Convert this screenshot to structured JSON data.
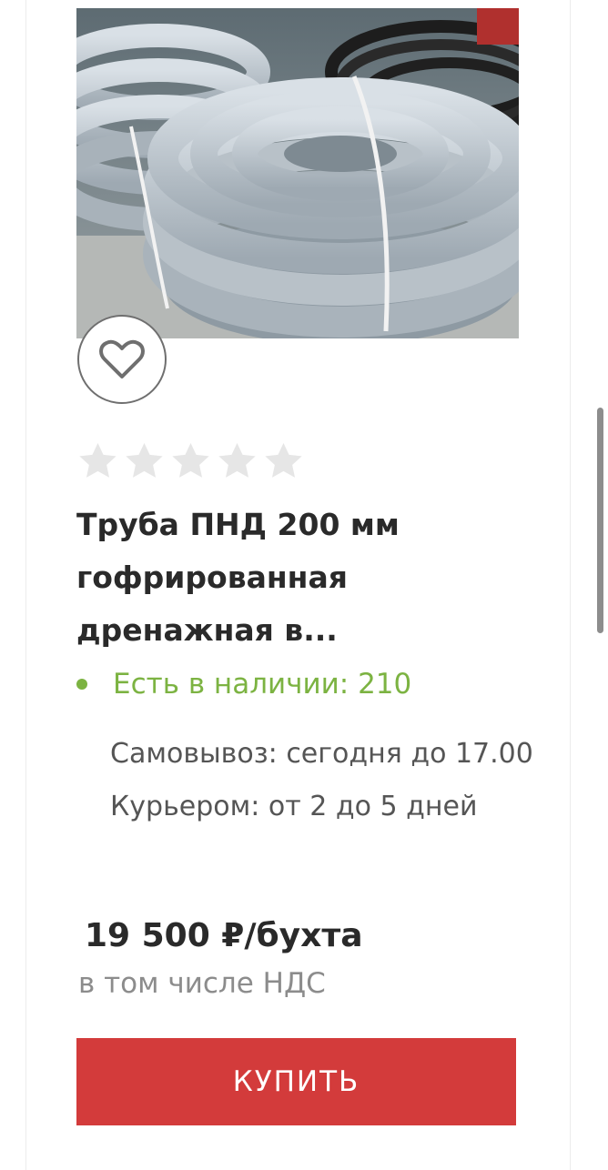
{
  "product": {
    "image_alt": "coiled drainage pipes",
    "rating": 0,
    "rating_max": 5,
    "title": "Труба ПНД 200 мм гофрированная дренажная в...",
    "stock_text": "Есть в наличии: 210",
    "delivery_pickup": "Самовывоз: сегодня до 17.00",
    "delivery_courier": "Курьером: от 2 до 5 дней",
    "price": "19 500 ₽/бухта",
    "vat_note": "в том числе НДС",
    "buy_label": "КУПИТЬ"
  },
  "icons": {
    "favorite": "heart-icon",
    "rating": "star-icon",
    "stock": "status-dot"
  },
  "colors": {
    "accent": "#d33b3b",
    "in_stock": "#7cb342",
    "star_empty": "#e6e6e6",
    "title": "#2a2a2a",
    "muted": "#8c8c8c"
  }
}
